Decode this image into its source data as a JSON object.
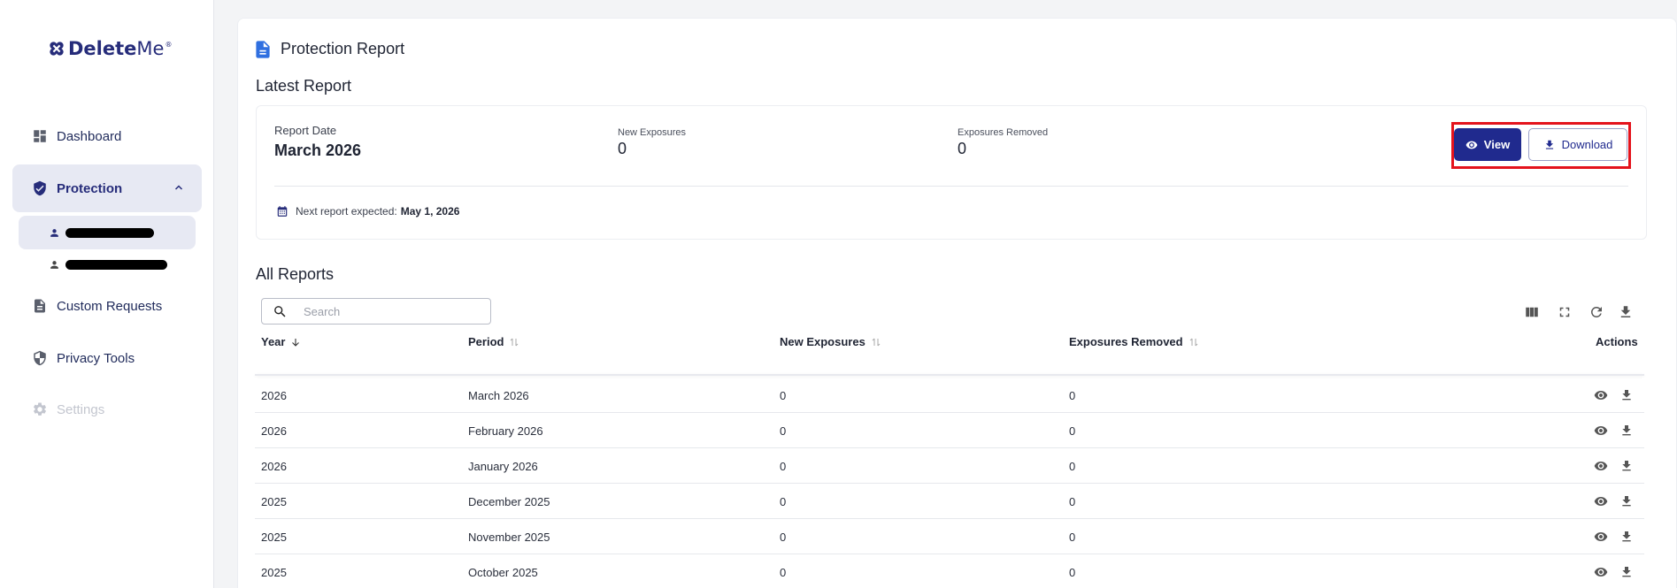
{
  "brand": {
    "name_strong": "Delete",
    "name_light": "Me",
    "reg": "®"
  },
  "sidebar": {
    "items": [
      {
        "label": "Dashboard"
      },
      {
        "label": "Protection"
      },
      {
        "label": "Custom Requests"
      },
      {
        "label": "Privacy Tools"
      },
      {
        "label": "Settings"
      }
    ]
  },
  "page": {
    "title": "Protection Report"
  },
  "latest": {
    "section_title": "Latest Report",
    "report_date_label": "Report Date",
    "report_date": "March 2026",
    "new_exposures_label": "New Exposures",
    "new_exposures": "0",
    "exposures_removed_label": "Exposures Removed",
    "exposures_removed": "0",
    "view_label": "View",
    "download_label": "Download",
    "next_prefix": "Next report expected:",
    "next_date": "May 1, 2026"
  },
  "all_reports": {
    "section_title": "All Reports",
    "search_placeholder": "Search",
    "columns": {
      "year": "Year",
      "period": "Period",
      "new": "New Exposures",
      "removed": "Exposures Removed",
      "actions": "Actions"
    },
    "rows": [
      {
        "year": "2026",
        "period": "March 2026",
        "new": "0",
        "removed": "0"
      },
      {
        "year": "2026",
        "period": "February 2026",
        "new": "0",
        "removed": "0"
      },
      {
        "year": "2026",
        "period": "January 2026",
        "new": "0",
        "removed": "0"
      },
      {
        "year": "2025",
        "period": "December 2025",
        "new": "0",
        "removed": "0"
      },
      {
        "year": "2025",
        "period": "November 2025",
        "new": "0",
        "removed": "0"
      },
      {
        "year": "2025",
        "period": "October 2025",
        "new": "0",
        "removed": "0"
      }
    ]
  },
  "colors": {
    "brand": "#262c7a",
    "primary_button": "#202a8e",
    "highlight": "#e4131c",
    "nav_active_bg": "#e7e9f3"
  },
  "icons": [
    "dashboard-icon",
    "shield-check-icon",
    "chevron-up-icon",
    "person-icon",
    "document-icon",
    "shield-half-icon",
    "gear-icon",
    "eye-icon",
    "download-icon",
    "calendar-icon",
    "search-icon",
    "columns-icon",
    "fullscreen-icon",
    "refresh-icon",
    "sort-desc-icon",
    "sort-both-icon"
  ]
}
